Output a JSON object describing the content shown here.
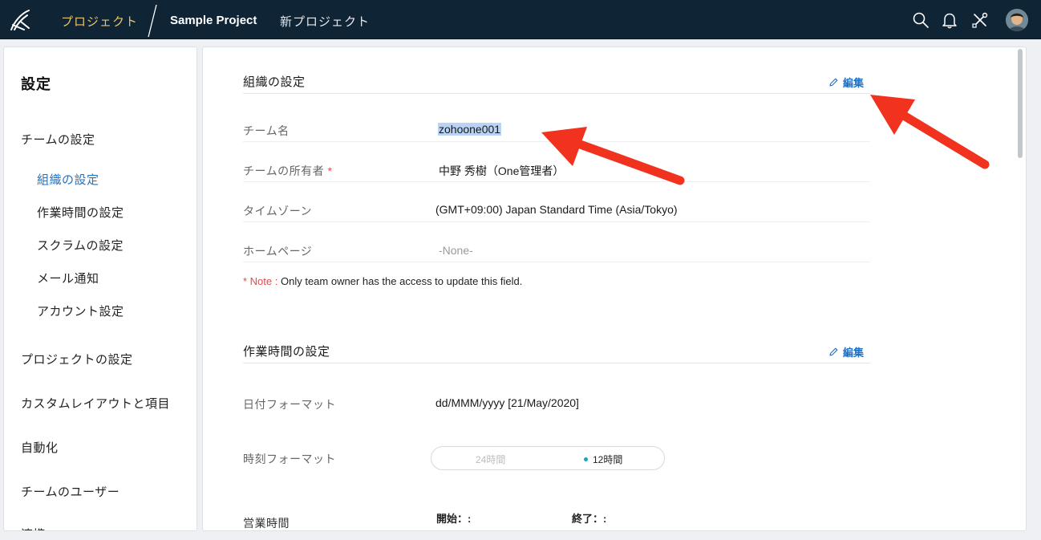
{
  "topbar": {
    "project_tab": "プロジェクト",
    "current_project": "Sample Project",
    "new_project": "新プロジェクト",
    "icons": [
      "search-icon",
      "bell-icon",
      "tools-icon"
    ]
  },
  "sidebar": {
    "title": "設定",
    "team_settings": "チームの設定",
    "sub_items": [
      {
        "label": "組織の設定",
        "active": true
      },
      {
        "label": "作業時間の設定"
      },
      {
        "label": "スクラムの設定"
      },
      {
        "label": "メール通知"
      },
      {
        "label": "アカウント設定"
      }
    ],
    "items": [
      {
        "label": "プロジェクトの設定"
      },
      {
        "label": "カスタムレイアウトと項目"
      },
      {
        "label": "自動化"
      },
      {
        "label": "チームのユーザー"
      },
      {
        "label": "連携"
      }
    ]
  },
  "org": {
    "title": "組織の設定",
    "edit": "編集",
    "rows": [
      {
        "label": "チーム名",
        "value": "zohoone001"
      },
      {
        "label": "チームの所有者",
        "required": "*",
        "value": "中野 秀樹（One管理者）"
      },
      {
        "label": "タイムゾーン",
        "value": "(GMT+09:00) Japan Standard Time (Asia/Tokyo)"
      },
      {
        "label": "ホームページ",
        "value": "-None-"
      }
    ],
    "note_label": "* Note :",
    "note_text": "Only team owner has the access to update this field."
  },
  "work": {
    "title": "作業時間の設定",
    "edit": "編集",
    "date_format_label": "日付フォーマット",
    "date_format_value": "dd/MMM/yyyy [21/May/2020]",
    "time_format_label": "時刻フォーマット",
    "time_options": [
      "24時間",
      "12時間"
    ],
    "selected_time": "12時間",
    "business_hours_label": "営業時間",
    "start_label": "開始：:",
    "end_label": "終了：:"
  },
  "colors": {
    "topbar": "#0f2435",
    "accent": "#1e73c8",
    "project_tab": "#e9c46a",
    "arrow": "#f0321e",
    "required": "#e34b4b"
  }
}
